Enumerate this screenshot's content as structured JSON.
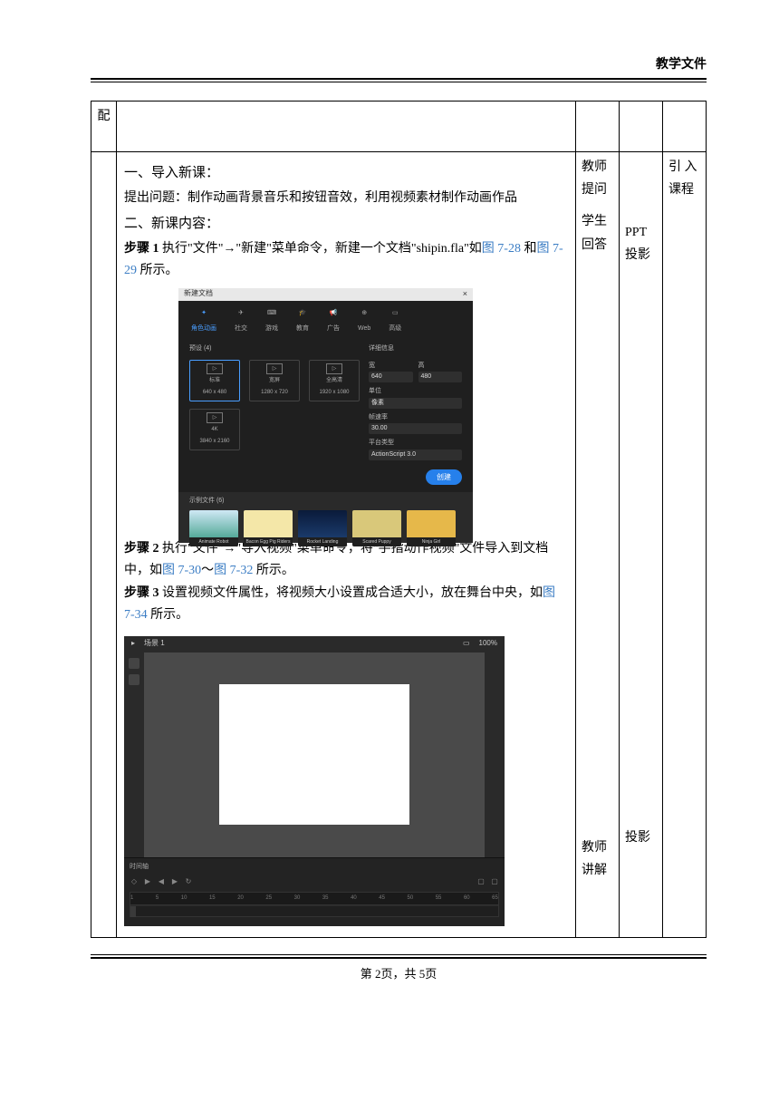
{
  "header": {
    "label": "教学文件"
  },
  "table": {
    "row0": {
      "label": "配"
    },
    "main": {
      "sec1_title": "一、导入新课：",
      "sec1_body": "提出问题：制作动画背景音乐和按钮音效，利用视频素材制作动画作品",
      "sec2_title": "二、新课内容：",
      "step1_label": "步骤 1",
      "step1_text_a": "   执行\"文件\"→\"新建\"菜单命令，新建一个文档\"shipin.fla\"如",
      "step1_fig1": "图 7-28",
      "step1_and": " 和",
      "step1_fig2": "图 7-29",
      "step1_text_b": " 所示。",
      "step2_label": "步骤 2",
      "step2_text_a": "   执行\"文件\"→\"导入视频\"菜单命令，将\"手指动作视频\"文件导入到文档中，如",
      "step2_fig1": "图 7-30",
      "step2_tilde": "～",
      "step2_fig2": "图 7-32",
      "step2_text_b": " 所示。",
      "step3_label": "步骤 3",
      "step3_text_a": "   设置视频文件属性，将视频大小设置成合适大小，放在舞台中央，如",
      "step3_fig1": "图 7-34",
      "step3_text_b": " 所示。"
    },
    "colA": {
      "r1": "教师",
      "r2": "提问",
      "r3": "学生",
      "r4": "回答",
      "r5": "教师",
      "r6": "讲解"
    },
    "colB": {
      "r1": "PPT",
      "r2": "投影",
      "r3": "投影"
    },
    "colC": {
      "r1": "引 入",
      "r2": "课程"
    }
  },
  "shot1": {
    "title": "新建文档",
    "tabs": [
      "角色动画",
      "社交",
      "游戏",
      "教育",
      "广告",
      "Web",
      "高级"
    ],
    "presets_label": "预设 (4)",
    "presets": [
      {
        "name": "标准",
        "size": "640 x 480"
      },
      {
        "name": "宽屏",
        "size": "1280 x 720"
      },
      {
        "name": "全高清",
        "size": "1920 x 1080"
      },
      {
        "name": "4K",
        "size": "3840 x 2160"
      }
    ],
    "details_title": "详细信息",
    "width_label": "宽",
    "width_val": "640",
    "height_label": "高",
    "height_val": "480",
    "unit_label": "单位",
    "unit_val": "像素",
    "fps_label": "帧速率",
    "fps_val": "30.00",
    "platform_label": "平台类型",
    "platform_val": "ActionScript 3.0",
    "create": "创建",
    "samples_label": "示例文件 (6)",
    "samples": [
      "Animate Robot",
      "Bacon Egg Pig Riders",
      "Rocket Landing",
      "Scared Puppy",
      "Ninja Girl"
    ]
  },
  "shot2": {
    "scene": "场景 1",
    "zoom": "100%",
    "timeline_label": "时间轴",
    "ruler": [
      "1",
      "5",
      "10",
      "15",
      "20",
      "25",
      "30",
      "35",
      "40",
      "45",
      "50",
      "55",
      "60",
      "65"
    ]
  },
  "footer": {
    "text": "第 2页，共 5页"
  }
}
